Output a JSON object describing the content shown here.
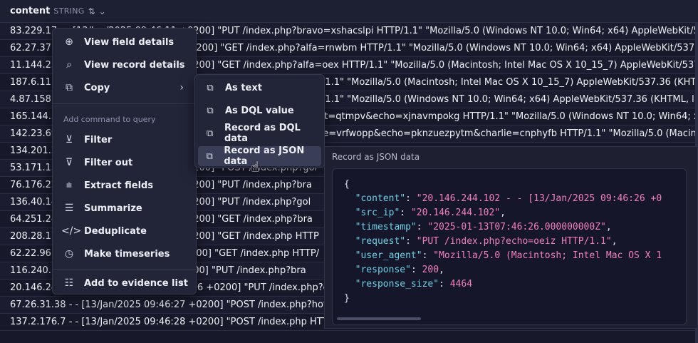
{
  "header": {
    "column": "content",
    "type": "STRING",
    "sort_icon": "sort-icon",
    "menu_icon": "chevron-down-icon"
  },
  "rows": [
    "83.229.17 - - [13/Jan/2025 09:46:11 +0200] \"PUT /index.php?bravo=xshacslpi HTTP/1.1\" \"Mozilla/5.0 (Windows NT 10.0; Win64; x64) AppleWebKit/53",
    "62.27.37.5 - - [13/Jan/2025 09:46:12 +0200] \"GET /index.php?alfa=rnwbm HTTP/1.1\" \"Mozilla/5.0 (Windows NT 10.0; Win64; x64) AppleWebKit/537.36 (K",
    "11.144.25 - - [13/Jan/2025 09:46:13 +0200] \"GET /index.php?alfa=oex HTTP/1.1\" \"Mozilla/5.0 (Macintosh; Intel Mac OS X 10_15_7) AppleWebKit/537",
    "187.6.11.1 - - [13/Jan/2025 09:46:14 +0200] \"GET /index.php HTTP/1.1\" \"Mozilla/5.0 (Macintosh; Intel Mac OS X 10_15_7) AppleWebKit/537.36 (KHTML,",
    "4.87.158.1 - - [13/Jan/2025 09:46:15 +0200] \"GET /index.php HTTP/1.1\" \"Mozilla/5.0 (Windows NT 10.0; Win64; x64) AppleWebKit/537.36 (KHTML, like G",
    "165.144.5 - - [13/Jan/2025 09:46:16 +0200] \"GET /index.php?foxtrot=qtmpv&echo=xjnavmpokg HTTP/1.1\" \"Mozilla/5.0 (Windows NT 10.0; Win64; x6",
    "142.23.69 - - [13/Jan/2025 09:46:17 +0200] \"GET /index.php?charlie=vrfwopp&echo=pknzuezpytm&charlie=cnphyfb HTTP/1.1\" \"Mozilla/5.0 (Macintos",
    "134.201.2 - - [13/Jan/2025 09:46:18 +0200] \"GET /index.php HTTP/1.1\" \"Mozilla/5.0 (Windows NT 10.0; Win64; x64) AppleWebKit/537.36 (KHTML, like",
    "53.171.15 - - [13/Jan/2025 09:46:19 +0200] \"POST /index.php?gol",
    "76.176.22 - - [13/Jan/2025 09:46:20 +0200] \"PUT /index.php?bra",
    "136.40.14 - - [13/Jan/2025 09:46:21 +0200] \"PUT /index.php?gol",
    "64.251.24 - - [13/Jan/2025 09:46:22 +0200] \"GET /index.php?bra",
    "208.28.17 - - [13/Jan/2025 09:46:23 +0200] \"GET /index.php HTTP",
    "62.22.96. - - [13/Jan/2025 09:46:24 +0200] \"GET /index.php HTTP/",
    "116.240. - - [13/Jan/2025 09:46:25 +0200] \"PUT /index.php?bra",
    "20.146.244.102 - - [13/Jan/2025 09:46:26 +0200] \"PUT /index.php?ech",
    "67.26.31.38 - - [13/Jan/2025 09:46:27 +0200] \"POST /index.php?hotel=",
    "137.2.176.7 - - [13/Jan/2025 09:46:28 +0200] \"POST /index.php HTTP/1.1\" \"Mozilla/5.0 (Windows NT 10.0; Win64; x64) AppleWebKit/537.36 (KHTML, like G"
  ],
  "menu": {
    "items_top": [
      {
        "label": "View field details",
        "icon": "zoom-in-icon"
      },
      {
        "label": "View record details",
        "icon": "search-icon"
      },
      {
        "label": "Copy",
        "icon": "copy-icon"
      }
    ],
    "section_label": "Add command to query",
    "items_commands": [
      {
        "label": "Filter",
        "icon": "filter-add-icon"
      },
      {
        "label": "Filter out",
        "icon": "filter-remove-icon"
      },
      {
        "label": "Extract fields",
        "icon": "extract-icon"
      },
      {
        "label": "Summarize",
        "icon": "summarize-icon"
      },
      {
        "label": "Deduplicate",
        "icon": "code-icon"
      },
      {
        "label": "Make timeseries",
        "icon": "clock-icon"
      }
    ],
    "evidence": {
      "label": "Add to evidence list",
      "icon": "list-icon"
    }
  },
  "submenu": {
    "items": [
      {
        "label": "As text",
        "icon": "copy-icon"
      },
      {
        "label": "As DQL value",
        "icon": "copy-icon"
      },
      {
        "label": "Record as DQL data",
        "icon": "copy-icon"
      },
      {
        "label": "Record as JSON data",
        "icon": "copy-icon"
      }
    ],
    "hovered": "Record as JSON data"
  },
  "preview": {
    "title": "Record as JSON data",
    "content_value": "20.146.244.102 - - [13/Jan/2025 09:46:26 +0",
    "src_ip": "20.146.244.102",
    "timestamp": "2025-01-13T07:46:26.000000000Z",
    "request": "PUT /index.php?echo=oeiz HTTP/1.1",
    "user_agent": "Mozilla/5.0 (Macintosh; Intel Mac OS X 1",
    "response": "200",
    "response_size": "4464"
  }
}
